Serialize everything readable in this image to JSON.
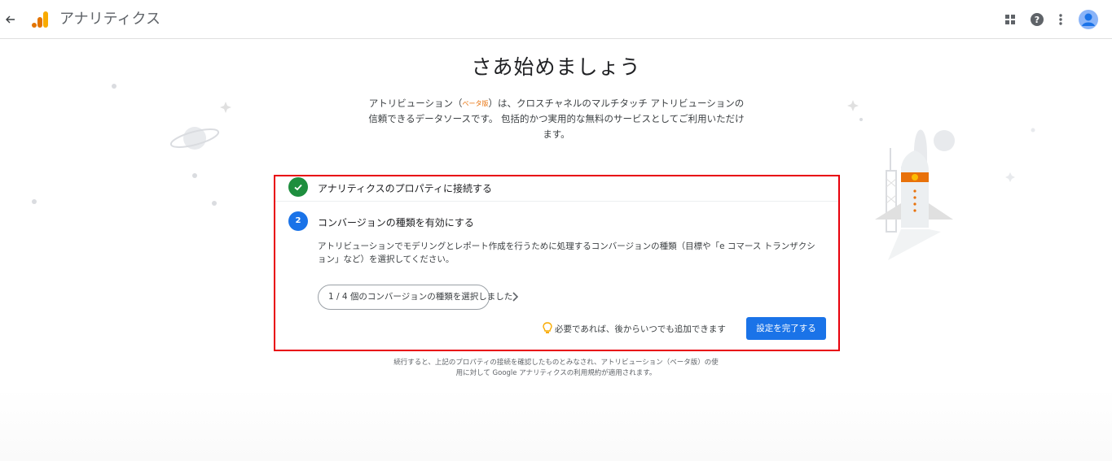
{
  "header": {
    "app_title": "アナリティクス",
    "back_icon": "arrow-back-icon",
    "logo_icon": "analytics-logo-icon",
    "actions": [
      "apps-grid-icon",
      "help-icon",
      "more-vert-icon",
      "account-avatar-icon"
    ]
  },
  "main": {
    "title": "さあ始めましょう",
    "intro_part1": "アトリビューション（",
    "intro_beta": "ベータ版",
    "intro_part2": "）は、クロスチャネルのマルチタッチ アトリビューションの信頼できるデータソースです。 包括的かつ実用的な無料のサービスとしてご利用いただけます。"
  },
  "steps": {
    "step1": {
      "icon": "check-icon",
      "label": "アナリティクスのプロパティに接続する"
    },
    "step2": {
      "number": "2",
      "label": "コンバージョンの種類を有効にする",
      "description": "アトリビューションでモデリングとレポート作成を行うために処理するコンバージョンの種類（目標や「e コマース トランザクション」など）を選択してください。",
      "select_label": "1 / 4 個のコンバージョンの種類を選択しました",
      "hint": "必要であれば、後からいつでも追加できます",
      "finish_button": "設定を完了する"
    }
  },
  "footer": {
    "text": "続行すると、上記のプロパティの接続を確認したものとみなされ、アトリビューション（ベータ版）の使用に対して Google アナリティクスの利用規約が適用されます。"
  },
  "colors": {
    "primary": "#1a73e8",
    "success": "#1e8e3e",
    "highlight_border": "#e8000b",
    "logo_orange": "#f9ab00",
    "logo_dark_orange": "#e37400",
    "beta": "#e8710a"
  }
}
